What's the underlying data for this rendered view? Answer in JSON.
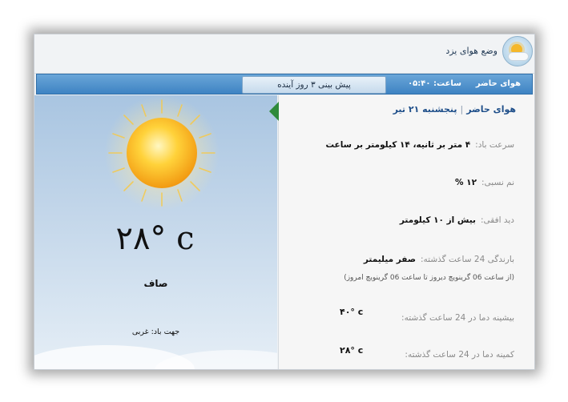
{
  "app": {
    "title": "وضع هوای یزد",
    "logo_icon": "sun-cloud-icon"
  },
  "nav": {
    "current_label": "هوای حاضر",
    "time_label": "ساعت: ۰۵:۴۰",
    "forecast_button": "پیش بینی ۳ روز آینده"
  },
  "current": {
    "temperature": "۲۸° c",
    "condition": "صاف",
    "wind_direction": "جهت باد: غربی",
    "icon": "sun-icon"
  },
  "details": {
    "heading_title": "هوای حاضر",
    "heading_date": "پنجشنبه ۲۱ تیر",
    "wind_speed_label": "سرعت باد:",
    "wind_speed_value": "۴ متر بر ثانیه، ۱۴ کیلومتر بر ساعت",
    "humidity_label": "نم نسبی:",
    "humidity_value": "۱۲ %",
    "visibility_label": "دید افقی:",
    "visibility_value": "بیش از ۱۰ کیلومتر",
    "rain_label": "بارندگی 24 ساعت گذشته:",
    "rain_value": "صفر میلیمتر",
    "rain_note": "(از ساعت 06 گرینویچ دیروز تا ساعت 06 گرینویچ امروز)",
    "max_label": "بیشینه دما در 24 ساعت گذشته:",
    "max_value": "۴۰° c",
    "min_label": "کمینه دما در 24 ساعت گذشته:",
    "min_value": "۲۸° c"
  },
  "colors": {
    "nav_blue": "#3e83c3",
    "heading_blue": "#1f4f8a",
    "marker_green": "#2f8a3b"
  }
}
